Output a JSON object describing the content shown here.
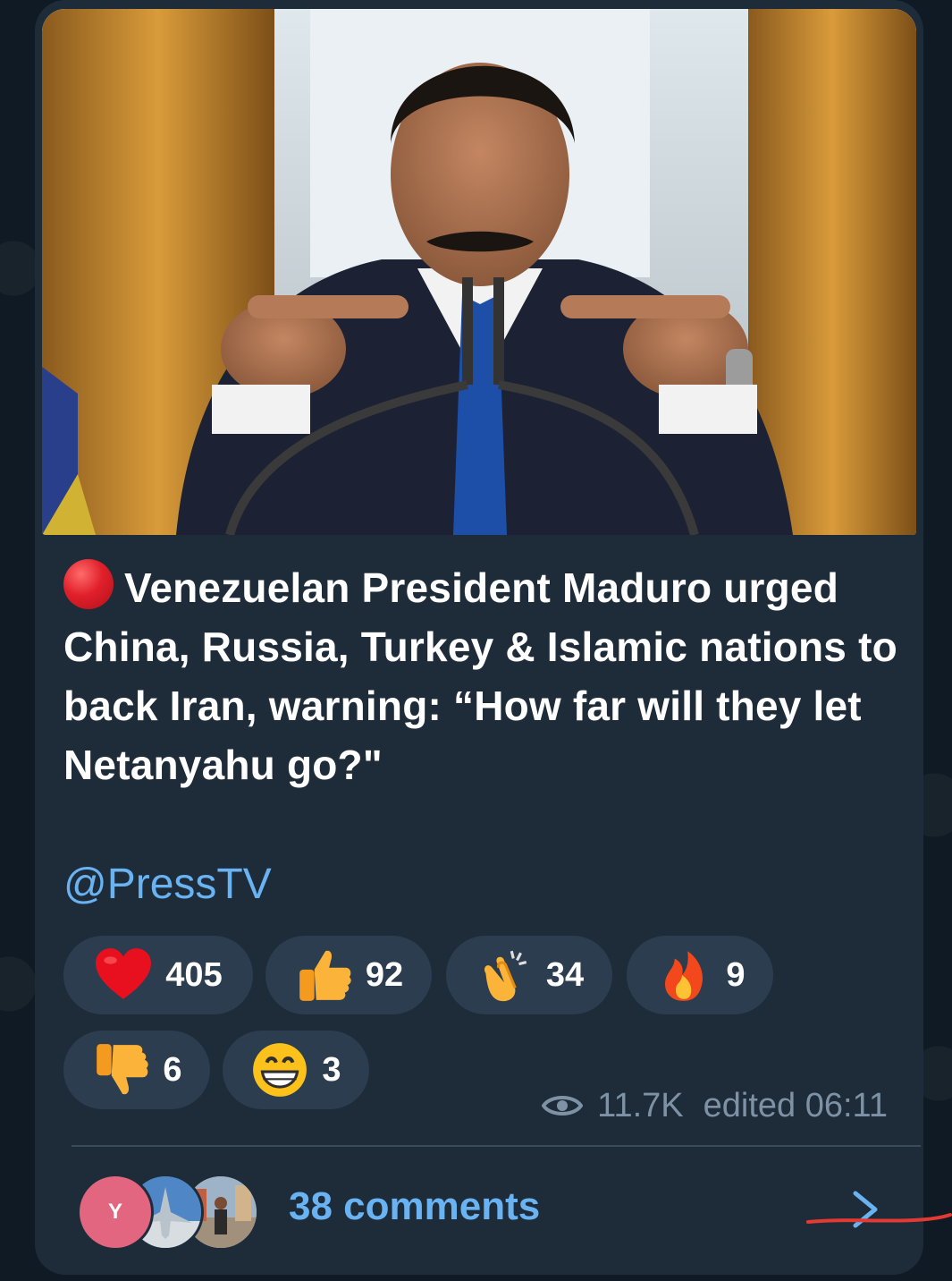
{
  "post": {
    "photo_alt": "Man in suit speaking at microphones",
    "status_emoji": "red-circle",
    "caption": "Venezuelan President Maduro urged China, Russia, Turkey & Islamic nations to back Iran, warning: “How far will they let Netanyahu go?\"",
    "handle": "@PressTV",
    "views": "11.7K",
    "edited_time": "edited 06:11"
  },
  "reactions": [
    {
      "icon": "red-heart",
      "count": "405"
    },
    {
      "icon": "thumbs-up",
      "count": "92"
    },
    {
      "icon": "clapping-hands",
      "count": "34"
    },
    {
      "icon": "fire",
      "count": "9"
    },
    {
      "icon": "thumbs-down",
      "count": "6"
    },
    {
      "icon": "grinning-face",
      "count": "3"
    }
  ],
  "comments": {
    "first_avatar_initial": "Y",
    "label": "38 comments"
  },
  "colors": {
    "bubble": "#1e2c3a",
    "accent": "#6ab3f3",
    "reaction_bg": "#2b3d4f",
    "meta": "#7f92a5"
  }
}
